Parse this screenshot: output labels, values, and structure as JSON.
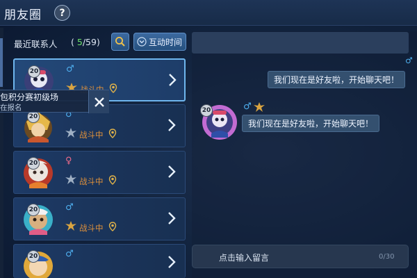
{
  "header": {
    "title": "朋友圈",
    "help_icon": "question-mark-icon",
    "help_label": "?"
  },
  "contacts": {
    "label": "最近联系人",
    "online": "5",
    "total": "59",
    "search_icon": "search-icon",
    "sort_label": "互动时间",
    "sort_icon": "chevron-down-icon",
    "items": [
      {
        "level": "20",
        "gender": "♂",
        "gender_color": "#4fb0f0",
        "status": "战斗中",
        "rank": "gold",
        "selected": true
      },
      {
        "level": "20",
        "gender": "♂",
        "gender_color": "#4fb0f0",
        "status": "战斗中",
        "rank": "silver",
        "selected": false
      },
      {
        "level": "20",
        "gender": "♀",
        "gender_color": "#f06b8a",
        "status": "战斗中",
        "rank": "silver",
        "selected": false
      },
      {
        "level": "20",
        "gender": "♂",
        "gender_color": "#4fb0f0",
        "status": "战斗中",
        "rank": "gold",
        "selected": false
      },
      {
        "level": "20",
        "gender": "♂",
        "gender_color": "#4fb0f0",
        "status": "",
        "rank": "",
        "selected": false
      }
    ]
  },
  "popup": {
    "title": "包积分赛初级场",
    "subtitle": "在报名",
    "close_icon": "close-icon"
  },
  "chat": {
    "gender_symbol": "♂",
    "sent_message": "我们现在是好友啦，开始聊天吧！",
    "received_message": "我们现在是好友啦，开始聊天吧！",
    "received_level": "20",
    "input_placeholder": "点击输入留言",
    "char_count": "0/30"
  },
  "colors": {
    "accent": "#6fb6ee",
    "status": "#e0913a",
    "online": "#6ee36b",
    "male": "#4fb0f0",
    "female": "#f06b8a"
  }
}
